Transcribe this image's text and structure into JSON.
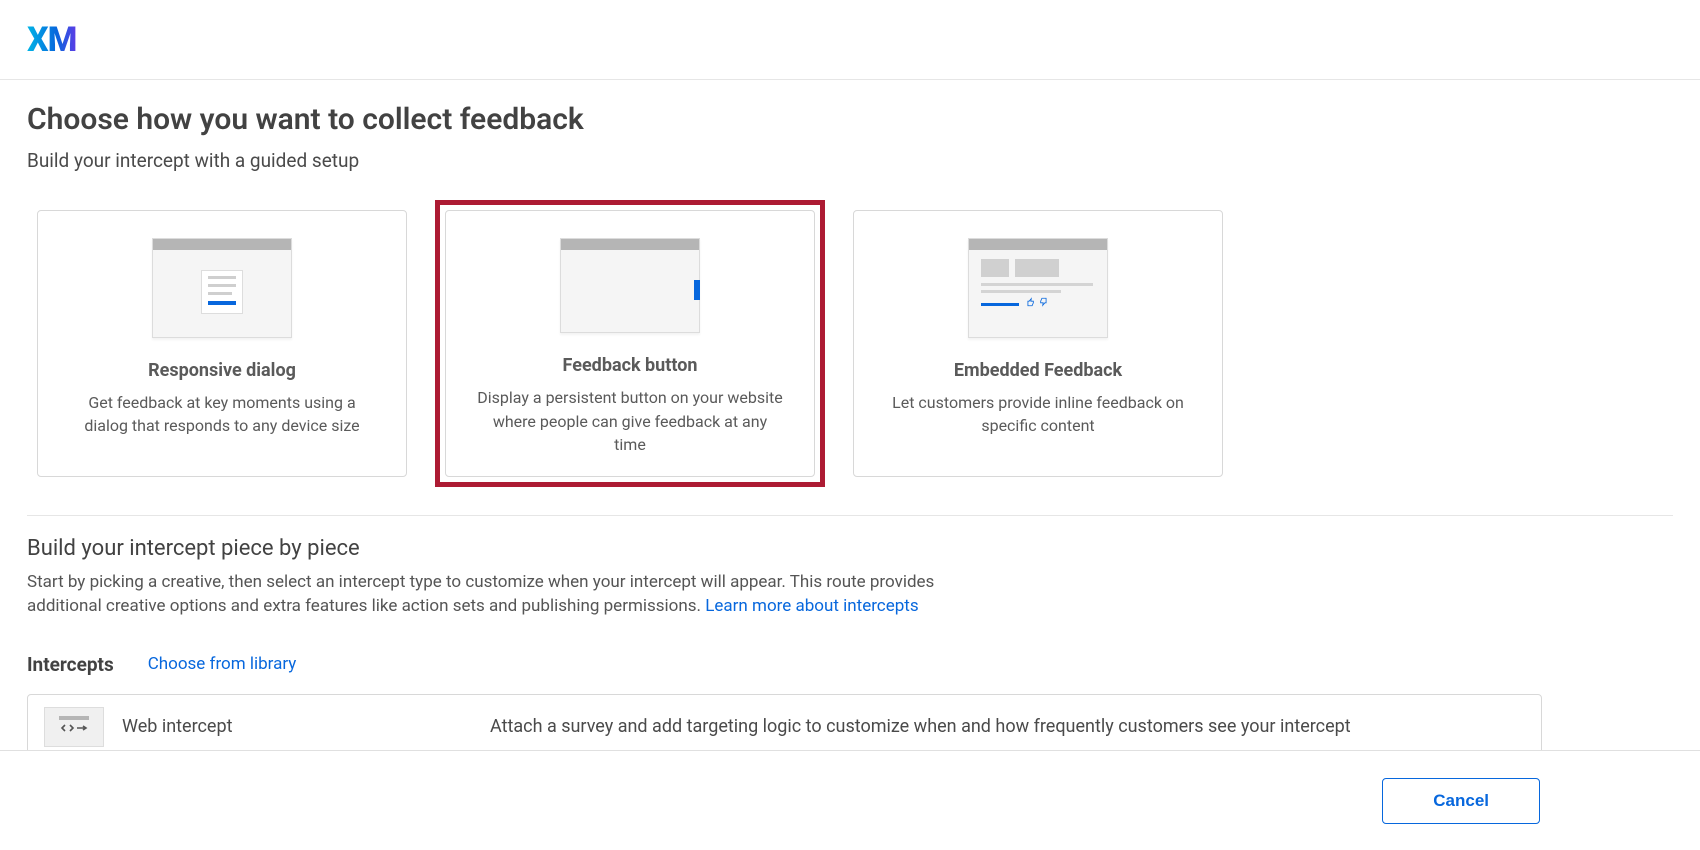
{
  "logo": "XM",
  "page_title": "Choose how you want to collect feedback",
  "subtitle": "Build your intercept with a guided setup",
  "cards": [
    {
      "title": "Responsive dialog",
      "desc": "Get feedback at key moments using a dialog that responds to any device size",
      "highlighted": false
    },
    {
      "title": "Feedback button",
      "desc": "Display a persistent button on your website where people can give feedback at any time",
      "highlighted": true
    },
    {
      "title": "Embedded Feedback",
      "desc": "Let customers provide inline feedback on specific content",
      "highlighted": false
    }
  ],
  "section2": {
    "title": "Build your intercept piece by piece",
    "desc": "Start by picking a creative, then select an intercept type to customize when your intercept will appear. This route provides additional creative options and extra features like action sets and publishing permissions. ",
    "link": "Learn more about intercepts"
  },
  "intercepts": {
    "label": "Intercepts",
    "choose": "Choose from library",
    "item_title": "Web intercept",
    "item_desc": "Attach a survey and add targeting logic to customize when and how frequently customers see your intercept"
  },
  "footer": {
    "cancel": "Cancel"
  }
}
